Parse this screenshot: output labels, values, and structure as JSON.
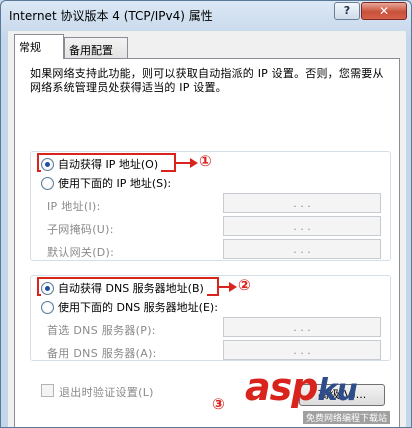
{
  "window": {
    "title": "Internet 协议版本 4 (TCP/IPv4) 属性",
    "help_label": "?",
    "close_label": "✕"
  },
  "tabs": [
    {
      "label": "常规",
      "active": true
    },
    {
      "label": "备用配置",
      "active": false
    }
  ],
  "description": "如果网络支持此功能，则可以获取自动指派的 IP 设置。否则，您需要从网络系统管理员处获得适当的 IP 设置。",
  "ip_section": {
    "auto_label": "自动获得 IP 地址(O)",
    "auto_selected": true,
    "manual_label": "使用下面的 IP 地址(S):",
    "fields": [
      {
        "label": "IP 地址(I):",
        "value": ". . ."
      },
      {
        "label": "子网掩码(U):",
        "value": ". . ."
      },
      {
        "label": "默认网关(D):",
        "value": ". . ."
      }
    ]
  },
  "dns_section": {
    "auto_label": "自动获得 DNS 服务器地址(B)",
    "auto_selected": true,
    "manual_label": "使用下面的 DNS 服务器地址(E):",
    "fields": [
      {
        "label": "首选 DNS 服务器(P):",
        "value": ". . ."
      },
      {
        "label": "备用 DNS 服务器(A):",
        "value": ". . ."
      }
    ]
  },
  "validate_label": "退出时验证设置(L)",
  "advanced_label": "高级(V)...",
  "annotations": {
    "marker1": "①",
    "marker2": "②",
    "marker3": "③"
  },
  "watermark": {
    "logo_main": "asp",
    "logo_ku": "ku",
    "subtitle": "免费网络编程下载站"
  },
  "colors": {
    "highlight": "#d9241e",
    "radio_dot": "#1c4fa8",
    "panel_bg": "#ffffff",
    "dialog_bg": "#f0f0f0"
  }
}
